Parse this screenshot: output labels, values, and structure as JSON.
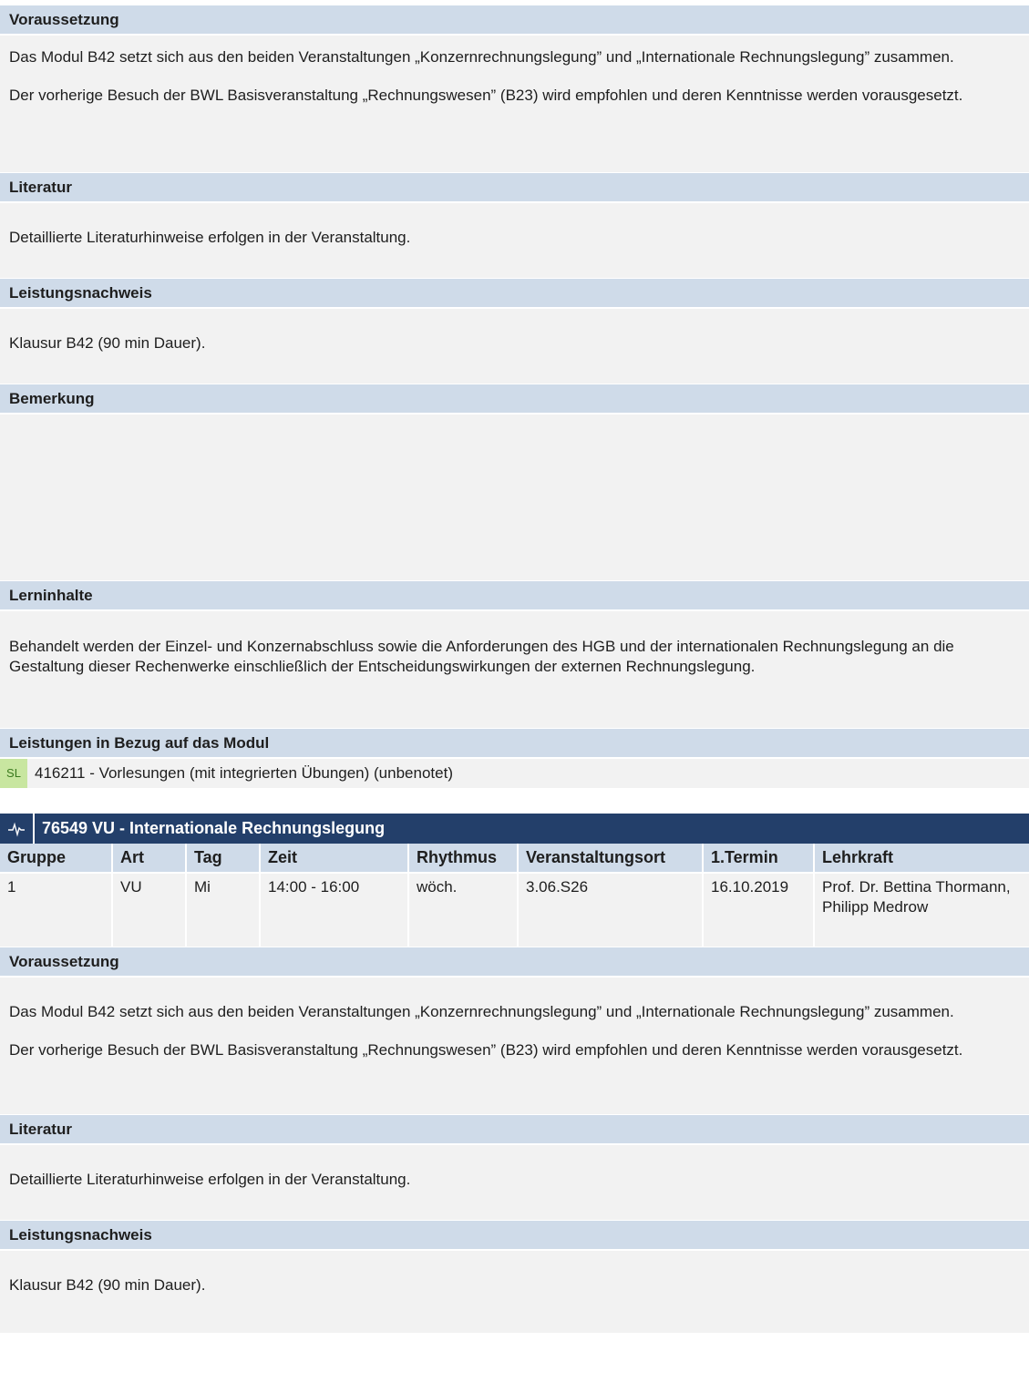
{
  "module": {
    "voraussetzung": {
      "heading": "Voraussetzung",
      "p1": "Das Modul B42 setzt sich aus den beiden Veranstaltungen „Konzernrechnungslegung” und „Internationale Rechnungslegung” zusammen.",
      "p2": "Der vorherige Besuch der BWL Basisveranstaltung „Rechnungswesen” (B23) wird empfohlen und deren Kenntnisse werden vorausgesetzt."
    },
    "literatur": {
      "heading": "Literatur",
      "text": "Detaillierte Literaturhinweise erfolgen in der Veranstaltung."
    },
    "leistungsnachweis": {
      "heading": "Leistungsnachweis",
      "text": "Klausur B42 (90 min Dauer)."
    },
    "bemerkung": {
      "heading": "Bemerkung"
    },
    "lerninhalte": {
      "heading": "Lerninhalte",
      "text": "Behandelt werden der Einzel- und Konzernabschluss sowie die Anforderungen des HGB und der internationalen Rechnungslegung an die Gestaltung dieser Rechenwerke einschließlich der Entscheidungswirkungen der externen Rechnungslegung."
    },
    "leistungen": {
      "heading": "Leistungen in Bezug auf das Modul",
      "badge": "SL",
      "item": "416211 - Vorlesungen (mit integrierten Übungen) (unbenotet)"
    }
  },
  "event": {
    "title": "76549 VU - Internationale Rechnungslegung",
    "icon": "pulse-icon",
    "columns": [
      "Gruppe",
      "Art",
      "Tag",
      "Zeit",
      "Rhythmus",
      "Veranstaltungsort",
      "1.Termin",
      "Lehrkraft"
    ],
    "rows": [
      [
        "1",
        "VU",
        "Mi",
        "14:00 - 16:00",
        "wöch.",
        "3.06.S26",
        "16.10.2019",
        "Prof. Dr. Bettina Thormann,  Philipp Medrow"
      ]
    ],
    "voraussetzung": {
      "heading": "Voraussetzung",
      "p1": "Das Modul B42 setzt sich aus den beiden Veranstaltungen „Konzernrechnungslegung” und „Internationale Rechnungslegung” zusammen.",
      "p2": "Der vorherige Besuch der BWL Basisveranstaltung „Rechnungswesen” (B23) wird empfohlen und deren Kenntnisse werden vorausgesetzt."
    },
    "literatur": {
      "heading": "Literatur",
      "text": "Detaillierte Literaturhinweise erfolgen in der Veranstaltung."
    },
    "leistungsnachweis": {
      "heading": "Leistungsnachweis",
      "text": "Klausur B42 (90 min Dauer)."
    }
  }
}
